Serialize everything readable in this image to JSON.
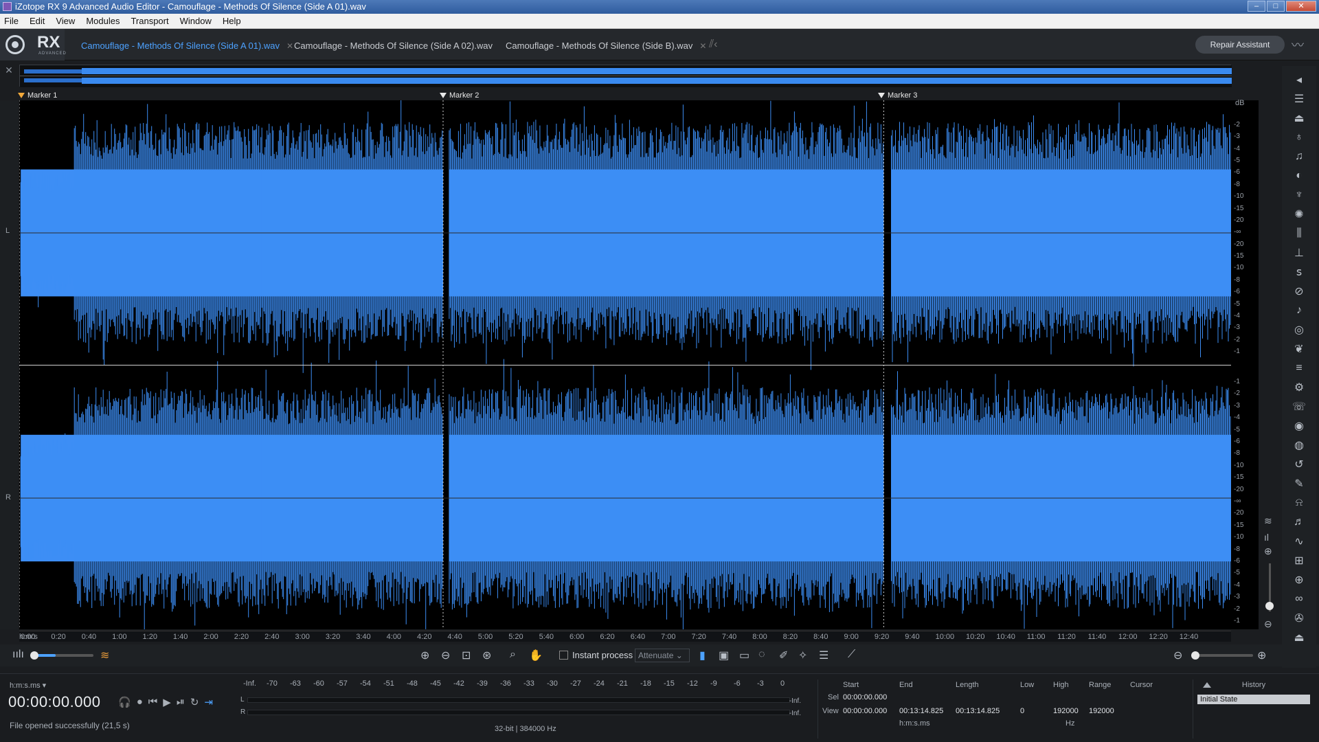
{
  "window": {
    "title": "iZotope RX 9 Advanced Audio Editor - Camouflage - Methods Of Silence (Side A 01).wav"
  },
  "menu": [
    "File",
    "Edit",
    "View",
    "Modules",
    "Transport",
    "Window",
    "Help"
  ],
  "logo": {
    "text": "RX",
    "sub": "ADVANCED"
  },
  "tabs": [
    {
      "label": "Camouflage - Methods Of Silence (Side A 01).wav",
      "active": true
    },
    {
      "label": "Camouflage - Methods Of Silence (Side A 02).wav",
      "active": false
    },
    {
      "label": "Camouflage - Methods Of Silence (Side B).wav",
      "active": false
    }
  ],
  "repair_assistant": "Repair Assistant",
  "markers": [
    {
      "label": "Marker 1",
      "time": "0:00"
    },
    {
      "label": "Marker 2",
      "time": "4:38"
    },
    {
      "label": "Marker 3",
      "time": "9:27"
    }
  ],
  "channels": [
    "L",
    "R"
  ],
  "db_scale": {
    "unit": "dB",
    "top_ticks": [
      "-2",
      "-3",
      "-4",
      "-5",
      "-6",
      "-8",
      "-10",
      "-15",
      "-20",
      "-∞",
      "-20",
      "-15",
      "-10",
      "-8",
      "-6",
      "-5",
      "-4",
      "-3",
      "-2",
      "-1"
    ],
    "bottom_ticks": [
      "-1",
      "-2",
      "-3",
      "-4",
      "-5",
      "-6",
      "-8",
      "-10",
      "-15",
      "-20",
      "-∞",
      "-20",
      "-15",
      "-10",
      "-8",
      "-6",
      "-5",
      "-4",
      "-3",
      "-2",
      "-1"
    ]
  },
  "ruler": [
    "0:00",
    "0:20",
    "0:40",
    "1:00",
    "1:20",
    "1:40",
    "2:00",
    "2:20",
    "2:40",
    "3:00",
    "3:20",
    "3:40",
    "4:00",
    "4:20",
    "4:40",
    "5:00",
    "5:20",
    "5:40",
    "6:00",
    "6:20",
    "6:40",
    "7:00",
    "7:20",
    "7:40",
    "8:00",
    "8:20",
    "8:40",
    "9:00",
    "9:20",
    "9:40",
    "10:00",
    "10:20",
    "10:40",
    "11:00",
    "11:20",
    "11:40",
    "12:00",
    "12:20",
    "12:40",
    "h:m:s"
  ],
  "toolbar": {
    "instant_process": "Instant process",
    "mode": "Attenuate"
  },
  "transport": {
    "time_format": "h:m:s.ms",
    "timecode": "00:00:00.000",
    "status": "File opened successfully (21,5 s)"
  },
  "meter": {
    "scale": [
      "-Inf.",
      "-70",
      "-63",
      "-60",
      "-57",
      "-54",
      "-51",
      "-48",
      "-45",
      "-42",
      "-39",
      "-36",
      "-33",
      "-30",
      "-27",
      "-24",
      "-21",
      "-18",
      "-15",
      "-12",
      "-9",
      "-6",
      "-3",
      "0"
    ],
    "left_label": "L",
    "right_label": "R",
    "left_value": "-Inf.",
    "right_value": "-Inf.",
    "format": "32-bit | 384000 Hz"
  },
  "selection": {
    "headers": {
      "start": "Start",
      "end": "End",
      "length": "Length",
      "low": "Low",
      "high": "High",
      "range": "Range",
      "cursor": "Cursor"
    },
    "sel_label": "Sel",
    "view_label": "View",
    "sel_start": "00:00:00.000",
    "view_start": "00:00:00.000",
    "view_end": "00:13:14.825",
    "view_length": "00:13:14.825",
    "low": "0",
    "high": "192000",
    "range": "192000",
    "time_unit": "h:m:s.ms",
    "freq_unit": "Hz"
  },
  "history": {
    "title": "History",
    "items": [
      "Initial State"
    ]
  },
  "colors": {
    "waveform": "#3d8ef5",
    "accent": "#4da2ff",
    "marker_first": "#f2a93b"
  }
}
